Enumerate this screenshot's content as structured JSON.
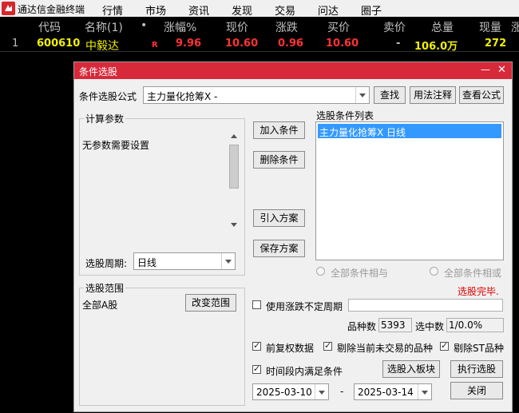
{
  "menubar": {
    "app_name": "通达信金融终端",
    "items": [
      "行情",
      "市场",
      "资讯",
      "发现",
      "交易",
      "问达",
      "圈子"
    ]
  },
  "quote_header": [
    "代码",
    "名称(1)",
    "•",
    "涨幅%",
    "现价",
    "涨跌",
    "买价",
    "卖价",
    "总量",
    "现量",
    "涨"
  ],
  "quote_row": {
    "index": "1",
    "code": "600610",
    "name": "中毅达",
    "flag": "R",
    "change_pct": "9.96",
    "price": "10.60",
    "change": "0.96",
    "bid": "10.60",
    "ask": "-",
    "volume": "106.0万",
    "last_vol": "272"
  },
  "dialog": {
    "title": "条件选股",
    "minimize": "—",
    "close": "✕",
    "formula_label": "条件选股公式",
    "formula_value": "主力量化抢筹X -",
    "find_btn": "查找",
    "usage_btn": "用法注释",
    "view_btn": "查看公式",
    "params_group": "计算参数",
    "params_text": "无参数需要设置",
    "period_label": "选股周期:",
    "period_value": "日线",
    "add_btn": "加入条件",
    "del_btn": "删除条件",
    "import_btn": "引入方案",
    "save_btn": "保存方案",
    "cond_list_label": "选股条件列表",
    "cond_items": [
      "主力量化抢筹X  日线"
    ],
    "radio_and": "全部条件相与",
    "radio_or": "全部条件相或",
    "status": "选股完毕.",
    "range_group": "选股范围",
    "range_value": "全部A股",
    "change_range_btn": "改变范围",
    "use_uncertain": "使用涨跌不定周期",
    "count_label": "品种数",
    "count_value": "5393",
    "selected_label": "选中数",
    "selected_value": "1/0.0%",
    "opt_fq": "前复权数据",
    "opt_exclude_untraded": "剔除当前未交易的品种",
    "opt_exclude_st": "剔除ST品种",
    "opt_period_all": "时间段内满足条件",
    "to_board_btn": "选股入板块",
    "execute_btn": "执行选股",
    "close_btn": "关闭",
    "date_from": "2025-03-10",
    "date_sep": "-",
    "date_to": "2025-03-14"
  },
  "colors": {
    "title_red": "#d8293a",
    "quote_yellow": "#f0f000",
    "quote_red": "#ff3232",
    "selected_blue": "#3399ff",
    "status_red": "#e00000"
  }
}
